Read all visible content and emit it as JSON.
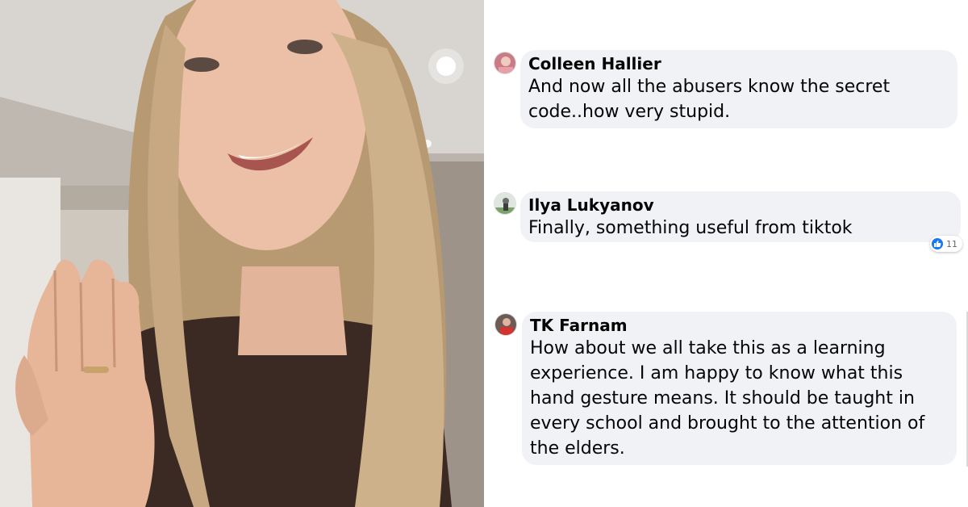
{
  "comments": [
    {
      "author": "Colleen Hallier",
      "text": "And now all the abusers know the secret code..how very stupid."
    },
    {
      "author": "Ilya Lukyanov",
      "text": "Finally, something useful from tiktok",
      "reaction_count": "11",
      "reaction_icon": "like-icon"
    },
    {
      "author": "TK Farnam",
      "text": "How about we all take this as a learning experience. I am happy to know what this hand gesture means. It should be taught in every school and brought to the attention of the elders."
    }
  ],
  "colors": {
    "bubble_bg": "#f0f2f5",
    "text": "#050505",
    "like_blue": "#1877f2"
  }
}
